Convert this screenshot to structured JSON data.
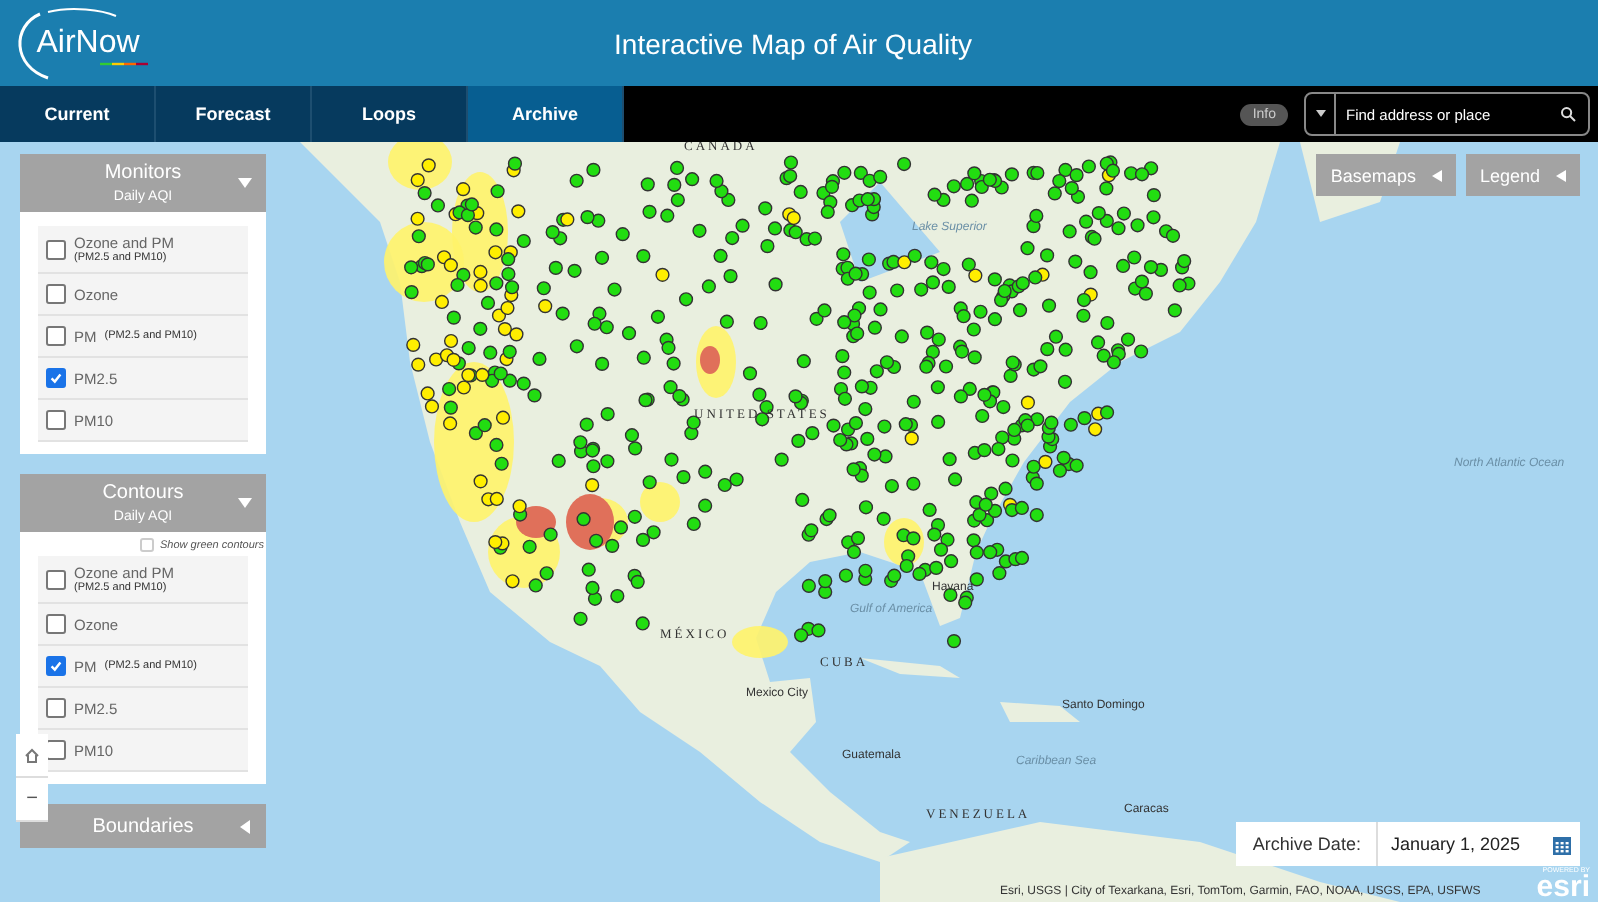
{
  "header": {
    "logo": "AirNow",
    "title": "Interactive Map of Air Quality"
  },
  "tabs": [
    {
      "label": "Current",
      "selected": false
    },
    {
      "label": "Forecast",
      "selected": false
    },
    {
      "label": "Loops",
      "selected": false
    },
    {
      "label": "Archive",
      "selected": true
    }
  ],
  "info": "Info",
  "search": {
    "placeholder": "Find address or place"
  },
  "panels": [
    {
      "kind": "checklist",
      "title": "Monitors",
      "subtitle": "Daily AQI",
      "expanded": true,
      "options": [
        {
          "kind": "two-line",
          "label": "Ozone and PM",
          "note": "(PM2.5 and PM10)",
          "checked": false
        },
        {
          "kind": "one-line",
          "label": "Ozone",
          "checked": false
        },
        {
          "kind": "one-line",
          "label": "PM",
          "note": "(PM2.5 and PM10)",
          "checked": false
        },
        {
          "kind": "one-line",
          "label": "PM2.5",
          "checked": true
        },
        {
          "kind": "one-line",
          "label": "PM10",
          "checked": false
        }
      ]
    },
    {
      "kind": "checklist",
      "title": "Contours",
      "subtitle": "Daily AQI",
      "expanded": true,
      "toggle": {
        "label": "Show green contours",
        "checked": false
      },
      "options": [
        {
          "kind": "two-line",
          "label": "Ozone and PM",
          "note": "(PM2.5 and PM10)",
          "checked": false
        },
        {
          "kind": "one-line",
          "label": "Ozone",
          "checked": false
        },
        {
          "kind": "one-line",
          "label": "PM",
          "note": "(PM2.5 and PM10)",
          "checked": true
        },
        {
          "kind": "one-line",
          "label": "PM2.5",
          "checked": false
        },
        {
          "kind": "one-line",
          "label": "PM10",
          "checked": false
        }
      ]
    },
    {
      "kind": "collapsed",
      "title": "Boundaries",
      "expanded": false
    }
  ],
  "zoom_controls": {
    "zoom_out": "−"
  },
  "map_buttons": [
    {
      "label": "Basemaps",
      "expanded": false
    },
    {
      "label": "Legend",
      "expanded": false
    }
  ],
  "map_labels": [
    {
      "text": "CANADA",
      "kind": "country"
    },
    {
      "text": "UNITED STATES",
      "kind": "country"
    },
    {
      "text": "MÉXICO",
      "kind": "country"
    },
    {
      "text": "CUBA",
      "kind": "country"
    },
    {
      "text": "VENEZUELA",
      "kind": "country"
    },
    {
      "text": "Mexico City",
      "kind": "city"
    },
    {
      "text": "Havana",
      "kind": "city"
    },
    {
      "text": "Santo Domingo",
      "kind": "city"
    },
    {
      "text": "Guatemala",
      "kind": "city"
    },
    {
      "text": "Caracas",
      "kind": "city"
    },
    {
      "text": "North Atlantic Ocean",
      "kind": "water"
    },
    {
      "text": "Gulf of America",
      "kind": "water"
    },
    {
      "text": "Caribbean Sea",
      "kind": "water"
    },
    {
      "text": "Lake Superior",
      "kind": "water"
    }
  ],
  "archive": {
    "label": "Archive Date:",
    "value": "January 1, 2025"
  },
  "attribution": "Esri, USGS | City of Texarkana, Esri, TomTom, Garmin, FAO, NOAA, USGS, EPA, USFWS",
  "esri_logo": {
    "tag": "POWERED BY",
    "name": "esri"
  }
}
